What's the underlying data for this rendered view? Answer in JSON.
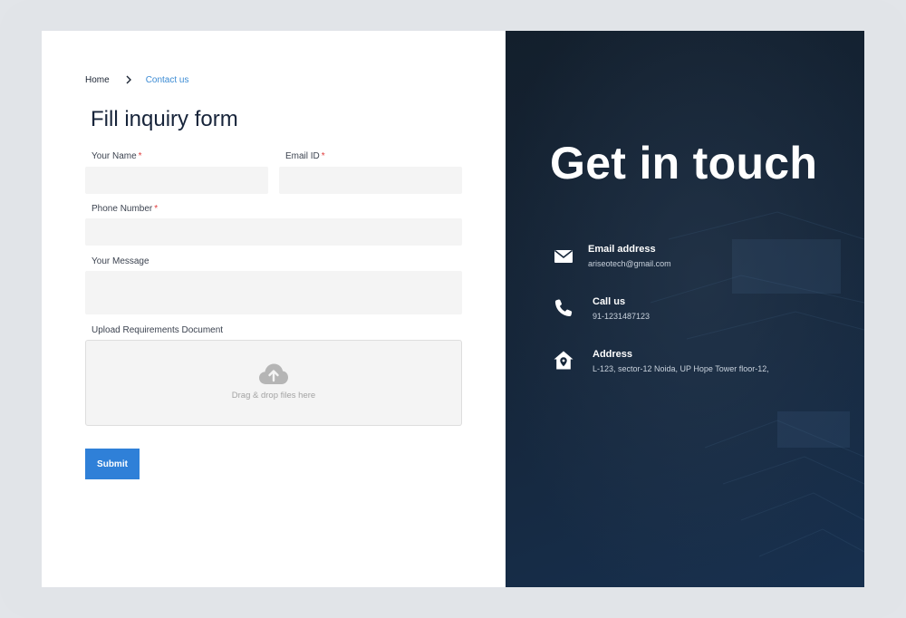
{
  "breadcrumb": {
    "home": "Home",
    "current": "Contact us"
  },
  "form": {
    "title": "Fill inquiry form",
    "name_label": "Your Name",
    "email_label": "Email ID",
    "phone_label": "Phone Number",
    "message_label": "Your Message",
    "upload_label": "Upload Requirements Document",
    "required_mark": "*",
    "dropzone_text": "Drag & drop files here",
    "submit_label": "Submit",
    "name_value": "",
    "email_value": "",
    "phone_value": "",
    "message_value": ""
  },
  "contact": {
    "headline": "Get in touch",
    "items": [
      {
        "title": "Email address",
        "value": "ariseotech@gmail.com",
        "icon": "envelope-icon"
      },
      {
        "title": "Call us",
        "value": "91-1231487123",
        "icon": "phone-icon"
      },
      {
        "title": "Address",
        "value": "L-123, sector-12 Noida, UP Hope Tower floor-12,",
        "icon": "home-location-icon"
      }
    ]
  },
  "colors": {
    "accent": "#2f80d8",
    "breadcrumb_active": "#3b8bd4",
    "required": "#e03b3b",
    "panel_dark": "#152538"
  }
}
